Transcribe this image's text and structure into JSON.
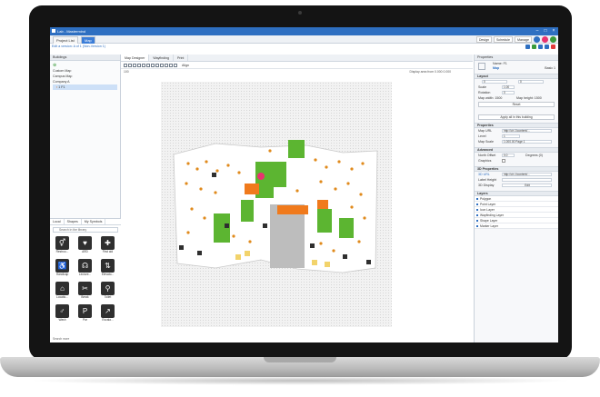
{
  "app": {
    "title": "Lab - Mastermind",
    "tabs": [
      {
        "label": "Project List"
      },
      {
        "label": "Map"
      }
    ],
    "toolbar_buttons": [
      {
        "label": "Design"
      },
      {
        "label": "Schedule"
      },
      {
        "label": "Manage"
      }
    ],
    "breadcrumb": "Edit a version: A of 1 (Non-Version 1)"
  },
  "left_panel": {
    "heading": "Buildings",
    "tree": [
      {
        "label": "Custom Map"
      },
      {
        "label": "Campus Map"
      },
      {
        "label": "Company A"
      },
      {
        "label": "1 F1"
      }
    ],
    "library_tabs": [
      {
        "label": "Local"
      },
      {
        "label": "Shapes"
      },
      {
        "label": "My Symbols"
      }
    ],
    "search_placeholder": "Search in the library",
    "symbols": [
      {
        "label": "Restroo..."
      },
      {
        "label": "ARD"
      },
      {
        "label": "First aid"
      },
      {
        "label": "Handicap"
      },
      {
        "label": "Lecture..."
      },
      {
        "label": "Elevato..."
      },
      {
        "label": "Locatio..."
      },
      {
        "label": "Break"
      },
      {
        "label": "Toilet"
      },
      {
        "label": "Wash"
      },
      {
        "label": "Par"
      },
      {
        "label": "Escala..."
      }
    ],
    "footer_label": "Search more"
  },
  "center": {
    "tabs": [
      {
        "label": "Map Designer"
      },
      {
        "label": "Wayfinding"
      },
      {
        "label": "Print"
      }
    ],
    "align_label": "Align",
    "zoom_value": "100",
    "display_area_label": "Display area from",
    "display_area_from": "0.000",
    "display_area_to": "0.000"
  },
  "right_panel": {
    "heading": "Properties",
    "name_label": "Name: F1",
    "type_label": "Map",
    "status_label": "Basic 1",
    "layout_section": "Layout",
    "x_value": "0",
    "y_value": "0",
    "scale_label": "Scale",
    "scale_value": "1.00",
    "rotation_label": "Rotation",
    "rotation_value": "0",
    "map_width_label": "Map width: 1500",
    "map_height_label": "Map height: 1500",
    "reset_label": "Reset",
    "apply_label": "Apply all in this building",
    "properties_section": "Properties",
    "map_url_label": "Map URL",
    "map_url_value": "http://ch.1/content/...",
    "level_label": "Level",
    "level_value": "1",
    "map_scale_label": "Map Scale",
    "map_scale_value": "1.000.00 Page 1",
    "advanced_section": "Advanced",
    "north_offset_label": "North Offset",
    "north_offset_value": "0.0",
    "degrees_label": "Degrees (0)",
    "graphics_label": "Graphics",
    "three_d_section": "3D Properties",
    "three_d_url_label": "3D URL",
    "three_d_url_value": "http://ch.1/content/...",
    "label_height_label": "Label Height",
    "three_d_display_label": "3D Display",
    "three_d_display_value": "Edit",
    "layers_section": "Layers",
    "layers": [
      {
        "label": "Polygon"
      },
      {
        "label": "Point Layer"
      },
      {
        "label": "Icon Layer"
      },
      {
        "label": "Wayfinding Layer"
      },
      {
        "label": "Shape Layer"
      },
      {
        "label": "Marker Layer"
      }
    ]
  },
  "colors": {
    "accent": "#2e6fc1",
    "green_room": "#5cb531",
    "orange_room": "#f07a1c",
    "pink_marker": "#e8336f",
    "lid": "#141414",
    "icon_dark": "#2f2f2f"
  }
}
